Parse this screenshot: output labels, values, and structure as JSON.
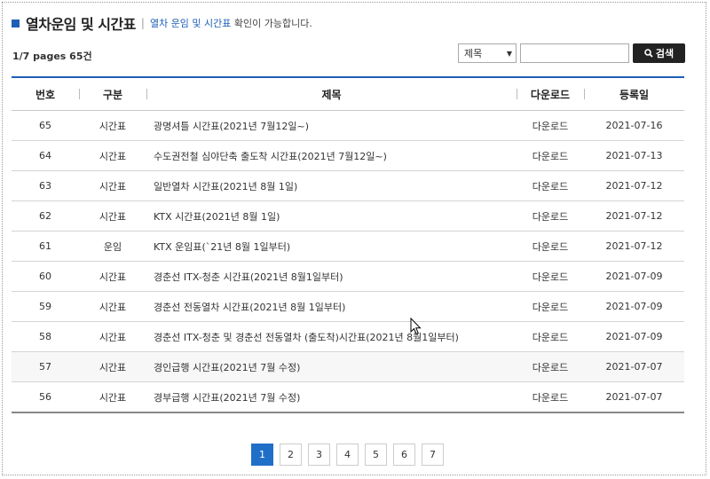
{
  "header": {
    "title": "열차운임 및 시간표",
    "separator": "|",
    "desc_highlight": "열차 운임 및 시간표",
    "desc_rest": " 확인이 가능합니다."
  },
  "count_text": "1/7 pages 65건",
  "search": {
    "select_value": "제목",
    "input_value": "",
    "button_label": "검색"
  },
  "table": {
    "headers": [
      "번호",
      "구분",
      "제목",
      "다운로드",
      "등록일"
    ],
    "rows": [
      {
        "no": "65",
        "type": "시간표",
        "title": "광명셔틀 시간표(2021년 7월12일~)",
        "download": "다운로드",
        "date": "2021-07-16"
      },
      {
        "no": "64",
        "type": "시간표",
        "title": "수도권전철 심야단축 출도착 시간표(2021년 7월12일~)",
        "download": "다운로드",
        "date": "2021-07-13"
      },
      {
        "no": "63",
        "type": "시간표",
        "title": "일반열차 시간표(2021년 8월 1일)",
        "download": "다운로드",
        "date": "2021-07-12"
      },
      {
        "no": "62",
        "type": "시간표",
        "title": "KTX 시간표(2021년 8월 1일)",
        "download": "다운로드",
        "date": "2021-07-12"
      },
      {
        "no": "61",
        "type": "운임",
        "title": "KTX 운임표(`21년 8월 1일부터)",
        "download": "다운로드",
        "date": "2021-07-12"
      },
      {
        "no": "60",
        "type": "시간표",
        "title": "경춘선 ITX-청춘 시간표(2021년 8월1일부터)",
        "download": "다운로드",
        "date": "2021-07-09"
      },
      {
        "no": "59",
        "type": "시간표",
        "title": "경춘선 전동열차 시간표(2021년 8월 1일부터)",
        "download": "다운로드",
        "date": "2021-07-09"
      },
      {
        "no": "58",
        "type": "시간표",
        "title": "경춘선 ITX-청춘 및 경춘선 전동열차 (출도착)시간표(2021년 8월1일부터)",
        "download": "다운로드",
        "date": "2021-07-09"
      },
      {
        "no": "57",
        "type": "시간표",
        "title": "경인급행 시간표(2021년 7월 수정)",
        "download": "다운로드",
        "date": "2021-07-07"
      },
      {
        "no": "56",
        "type": "시간표",
        "title": "경부급행 시간표(2021년 7월 수정)",
        "download": "다운로드",
        "date": "2021-07-07"
      }
    ]
  },
  "pagination": {
    "pages": [
      "1",
      "2",
      "3",
      "4",
      "5",
      "6",
      "7"
    ],
    "current": "1"
  },
  "colors": {
    "accent": "#1f5fb8",
    "active_page": "#1f6fc8",
    "search_button": "#222222"
  },
  "icons": {
    "title_bullet": "square-bullet-icon",
    "select_arrow": "chevron-down-icon",
    "search": "search-icon",
    "cursor": "mouse-pointer-icon"
  }
}
